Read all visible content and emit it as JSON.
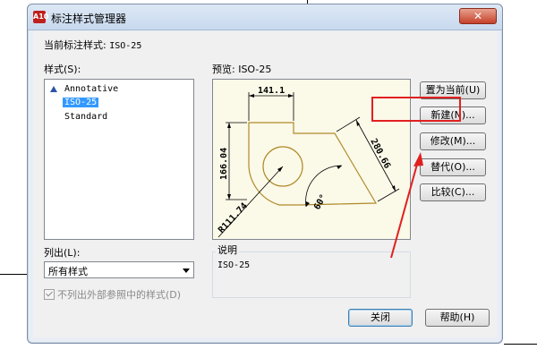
{
  "window": {
    "title": "标注样式管理器",
    "app_icon": "A10",
    "close_glyph": "✕"
  },
  "current_style": {
    "label": "当前标注样式:",
    "value": "ISO-25"
  },
  "styles_list": {
    "label": "样式(S):",
    "items": [
      {
        "label": "Annotative",
        "icon": "annotative-triangle-icon",
        "selected": false
      },
      {
        "label": "ISO-25",
        "selected": true
      },
      {
        "label": "Standard",
        "selected": false
      }
    ]
  },
  "preview": {
    "label": "预览: ISO-25",
    "dimensions": {
      "top": "141.1",
      "left": "166.04",
      "slant": "280.66",
      "angle": "60°",
      "radius": "R111.74"
    }
  },
  "list_filter": {
    "label": "列出(L):",
    "value": "所有样式"
  },
  "xref_checkbox": {
    "label": "不列出外部参照中的样式(D)",
    "checked": true,
    "disabled": true
  },
  "description": {
    "label": "说明",
    "text": "ISO-25"
  },
  "buttons": {
    "set_current": "置为当前(U)",
    "new": "新建(N)...",
    "modify": "修改(M)...",
    "override": "替代(O)...",
    "compare": "比较(C)...",
    "close": "关闭",
    "help": "帮助(H)"
  },
  "annotation_color": "#e02020"
}
